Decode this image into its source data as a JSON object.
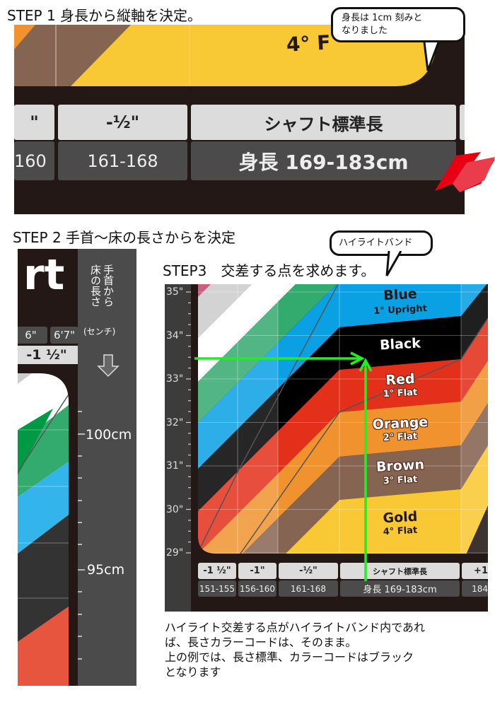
{
  "step1": {
    "title": "STEP 1 身長から縦軸を決定。",
    "bubble_line1": "身長は 1cm 刻みと",
    "bubble_line2": "なりました",
    "band_label": "4° F",
    "header_cells": [
      "\"",
      "-½\"",
      "シャフト標準長"
    ],
    "height_cells": [
      "160",
      "161-168",
      "身長 169-183cm"
    ]
  },
  "step2": {
    "title": "STEP 2 手首〜床の長さからを決定",
    "logo_fragment": "rt",
    "height_cells": [
      "6\"",
      "6'7\""
    ],
    "adjust_cell": "-1 ½\"",
    "column_heading_lines": [
      "手首から",
      "床の長さ"
    ],
    "column_heading_unit": "(センチ)",
    "arrow_icon": "down-arrow",
    "scale_labels": [
      "100cm",
      "95cm"
    ]
  },
  "step3": {
    "title": "STEP3　交差する点を求めます。",
    "bubble": "ハイライトバンド",
    "y_axis_labels": [
      "35\"",
      "34\"",
      "33\"",
      "32\"",
      "31\"",
      "30\"",
      "29\""
    ],
    "bands": [
      {
        "name": "Blue",
        "sub": "1° Upright",
        "color": "#0aa0e4"
      },
      {
        "name": "Black",
        "sub": "",
        "color": "#000000"
      },
      {
        "name": "Red",
        "sub": "1° Flat",
        "color": "#e3301a"
      },
      {
        "name": "Orange",
        "sub": "2° Flat",
        "color": "#f0932f"
      },
      {
        "name": "Brown",
        "sub": "3° Flat",
        "color": "#866452"
      },
      {
        "name": "Gold",
        "sub": "4° Flat",
        "color": "#f9c935"
      }
    ],
    "left_stripe_colors": {
      "pink": "#c0446e",
      "gray": "#cccccc",
      "white": "#ffffff",
      "green": "#33aa6e"
    },
    "arrow_color": "#22ee22",
    "header_cells": [
      "-1 ½\"",
      "-1\"",
      "-½\"",
      "シャフト標準長",
      "+1"
    ],
    "height_cells": [
      "151-155",
      "156-160",
      "161-168",
      "身長 169-183cm",
      "184"
    ]
  },
  "explanation": [
    "ハイライト交差する点がハイライトバンド内であれ",
    "ば、長さカラーコードは、そのまま。",
    "上の例では、長さ標準、カラーコードはブラック",
    "となります"
  ]
}
